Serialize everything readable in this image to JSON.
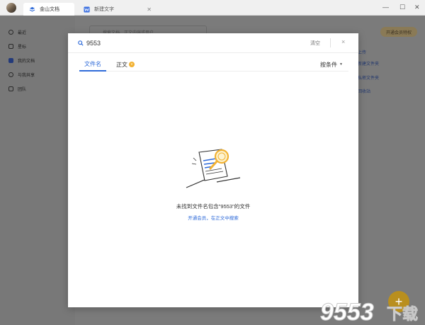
{
  "titlebar": {
    "tabs": [
      {
        "label": "金山文档",
        "active": true
      },
      {
        "label": "新建文字",
        "active": false
      }
    ],
    "controls": {
      "minimize": "—",
      "maximize": "☐",
      "close": "✕"
    }
  },
  "sidebar": {
    "items": [
      {
        "label": "最近",
        "icon": "clock-icon"
      },
      {
        "label": "星标",
        "icon": "star-icon"
      },
      {
        "label": "我的文档",
        "icon": "folder-icon",
        "active": true
      },
      {
        "label": "与我共享",
        "icon": "share-icon"
      },
      {
        "label": "团队",
        "icon": "team-icon"
      }
    ]
  },
  "background": {
    "search_placeholder": "搜索文档、正文内容或用户",
    "vip_button": "开通会员特权",
    "links": [
      "上传",
      "新建文件夹",
      "私密文件夹",
      "回收站"
    ]
  },
  "modal": {
    "search": {
      "value": "9553"
    },
    "clear_label": "清空",
    "close_label": "×",
    "tabs": [
      {
        "label": "文件名",
        "active": true
      },
      {
        "label": "正文",
        "vip": true
      }
    ],
    "filter_label": "按条件",
    "empty": {
      "message": "未找到文件名包含\"9553\"的文件",
      "link": "开通会员，在正文中搜索"
    }
  },
  "colors": {
    "accent": "#2f6bd9",
    "vip": "#f2b233",
    "overlay": "#7b7b7b"
  }
}
